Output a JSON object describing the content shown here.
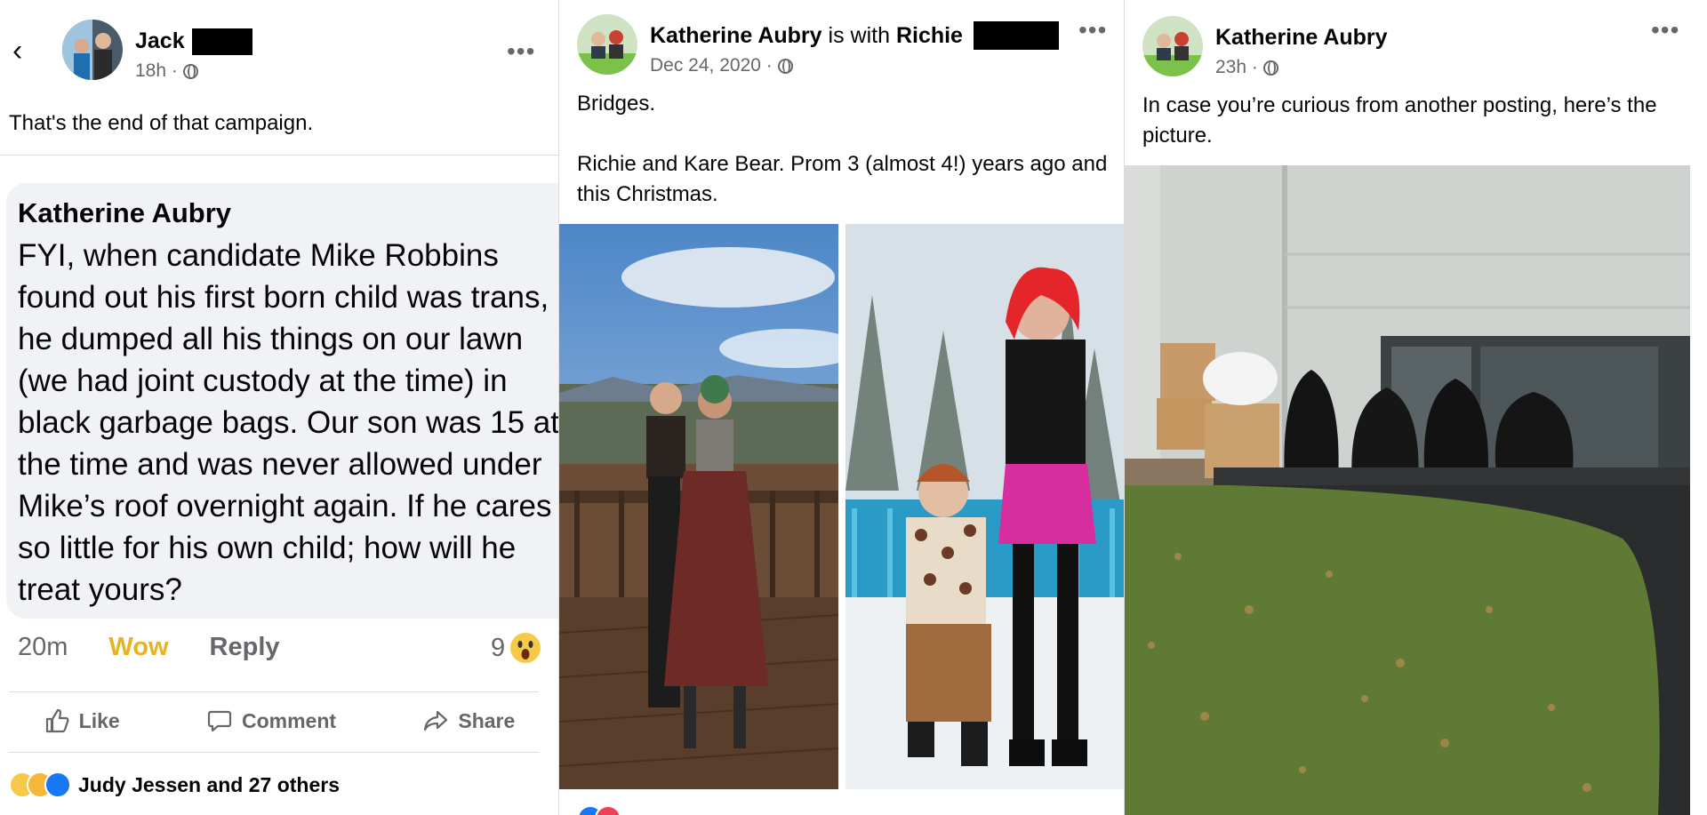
{
  "post1": {
    "back_icon": "chevron-left-icon",
    "author": "Jack",
    "time": "18h ·",
    "text": "That's the end of that campaign.",
    "quoted": {
      "author": "Katherine Aubry",
      "text": "FYI, when candidate Mike Robbins found out his first born child was trans, he dumped all his things on our lawn (we had joint custody at the time) in black garbage bags. Our son was 15 at the time and was never allowed under Mike’s roof overnight again. If he cares so little for his own child; how will he treat yours?",
      "time": "20m",
      "reaction": "Wow",
      "reply": "Reply",
      "count": "9"
    },
    "actions": {
      "like": "Like",
      "comment": "Comment",
      "share": "Share"
    },
    "reactions_text": "Judy Jessen and 27 others"
  },
  "post2": {
    "author": "Katherine Aubry",
    "with_text": "is with",
    "with_name": "Richie",
    "time": "Dec 24, 2020 ·",
    "line1": "Bridges.",
    "line2": "Richie and Kare Bear. Prom 3 (almost 4!) years ago and this Christmas."
  },
  "post3": {
    "author": "Katherine Aubry",
    "time": "23h ·",
    "text": "In case you’re curious from another posting, here’s the picture."
  },
  "colors": {
    "secondary_text": "#65676b",
    "wow": "#e6b422",
    "like_blue": "#1877f2",
    "bubble": "#f0f2f5"
  }
}
